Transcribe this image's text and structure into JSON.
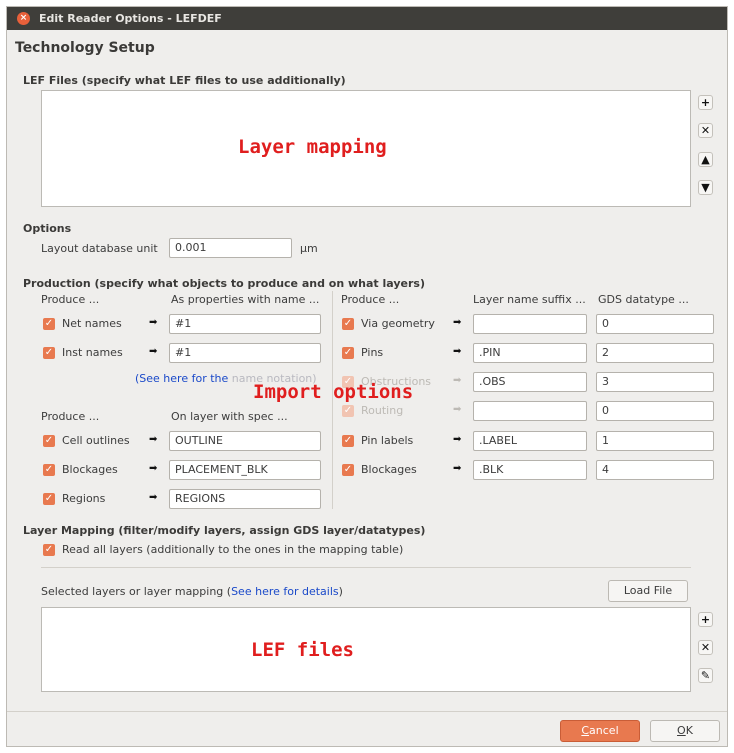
{
  "window": {
    "title": "Edit Reader Options - LEFDEF",
    "close_glyph": "×"
  },
  "heading": "Technology Setup",
  "lef_files": {
    "label": "LEF Files (specify what LEF files to use additionally)",
    "overlay": "Layer mapping",
    "buttons": [
      "add-icon",
      "remove-icon",
      "move-up-icon",
      "move-down-icon"
    ]
  },
  "options": {
    "label": "Options",
    "dbu_label": "Layout database unit",
    "dbu_value": "0.001",
    "dbu_unit": "µm"
  },
  "production": {
    "label": "Production (specify what objects to produce and on what layers)",
    "left_top": {
      "header_produce": "Produce ...",
      "header_props": "As properties with name ...",
      "rows": [
        {
          "label": "Net names",
          "value": "#1",
          "checked": true
        },
        {
          "label": "Inst names",
          "value": "#1",
          "checked": true
        }
      ],
      "link_prefix": "(See here for the ",
      "link_suffix": "name notation)"
    },
    "left_bottom": {
      "header_produce": "Produce ...",
      "header_layer": "On layer with spec ...",
      "rows": [
        {
          "label": "Cell outlines",
          "value": "OUTLINE",
          "checked": true
        },
        {
          "label": "Blockages",
          "value": "PLACEMENT_BLK",
          "checked": true
        },
        {
          "label": "Regions",
          "value": "REGIONS",
          "checked": true
        }
      ]
    },
    "right": {
      "header_produce": "Produce ...",
      "header_suffix": "Layer name suffix ...",
      "header_datatype": "GDS datatype ...",
      "rows": [
        {
          "label": "Via geometry",
          "suffix": "",
          "datatype": "0",
          "enabled": true
        },
        {
          "label": "Pins",
          "suffix": ".PIN",
          "datatype": "2",
          "enabled": true
        },
        {
          "label": "Obstructions",
          "suffix": ".OBS",
          "datatype": "3",
          "enabled": false
        },
        {
          "label": "Routing",
          "suffix": "",
          "datatype": "0",
          "enabled": false
        },
        {
          "label": "Pin labels",
          "suffix": ".LABEL",
          "datatype": "1",
          "enabled": true
        },
        {
          "label": "Blockages",
          "suffix": ".BLK",
          "datatype": "4",
          "enabled": true
        }
      ]
    },
    "overlay": "Import options"
  },
  "layer_mapping": {
    "label": "Layer Mapping (filter/modify layers, assign GDS layer/datatypes)",
    "read_all": "Read all layers (additionally to the ones in the mapping table)",
    "selected_prefix": "Selected layers or layer mapping (",
    "selected_link": "See here for details",
    "selected_suffix": ")",
    "load_file": "Load File",
    "overlay": "LEF files",
    "buttons": [
      "add-icon",
      "remove-icon",
      "edit-icon"
    ]
  },
  "footer": {
    "cancel": "Cancel",
    "ok": "OK"
  }
}
